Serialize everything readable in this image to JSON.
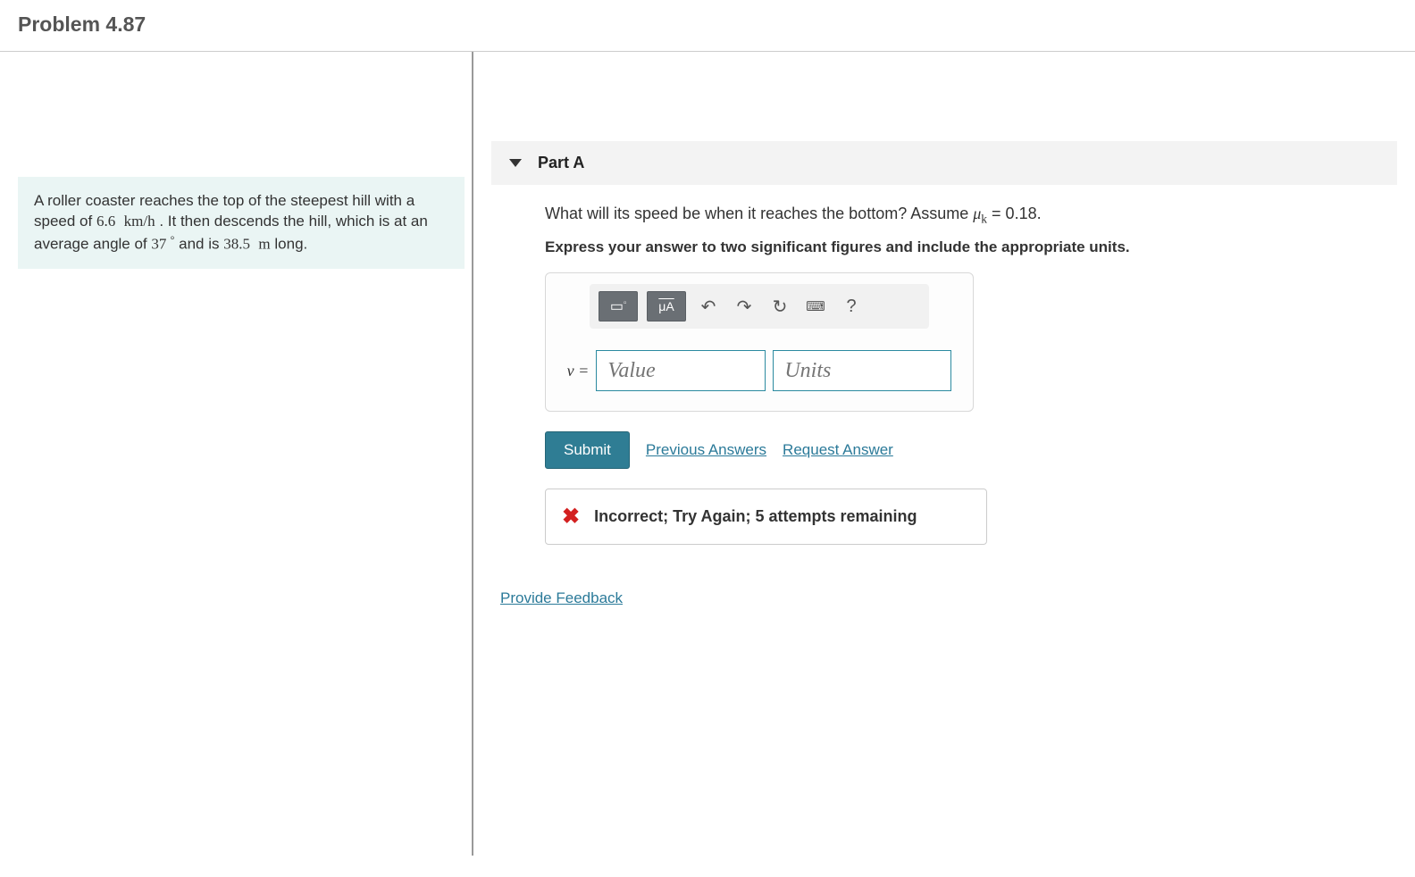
{
  "header": {
    "title": "Problem 4.87"
  },
  "problem": {
    "text_before_speed": "A roller coaster reaches the top of the steepest hill with a speed of ",
    "speed": "6.6",
    "speed_unit": "km/h",
    "text_after_speed": " . It then descends the hill, which is at an average angle of ",
    "angle": "37",
    "text_after_angle": " and is ",
    "length": "38.5",
    "length_unit": "m",
    "text_end": " long."
  },
  "part": {
    "label": "Part A",
    "question_before_mu": "What will its speed be when it reaches the bottom? Assume ",
    "mu_symbol": "μ",
    "mu_sub": "k",
    "mu_equals": " = 0.18.",
    "instruction": "Express your answer to two significant figures and include the appropriate units."
  },
  "toolbar": {
    "template_icon": "▢",
    "greek_label": "μA",
    "undo": "↶",
    "redo": "↷",
    "reset": "↻",
    "keyboard": "⌨",
    "help": "?"
  },
  "answer": {
    "variable": "v =",
    "value_placeholder": "Value",
    "units_placeholder": "Units"
  },
  "actions": {
    "submit": "Submit",
    "previous": "Previous Answers",
    "request": "Request Answer"
  },
  "feedback": {
    "message": "Incorrect; Try Again; 5 attempts remaining"
  },
  "footer": {
    "provide_feedback": "Provide Feedback"
  }
}
